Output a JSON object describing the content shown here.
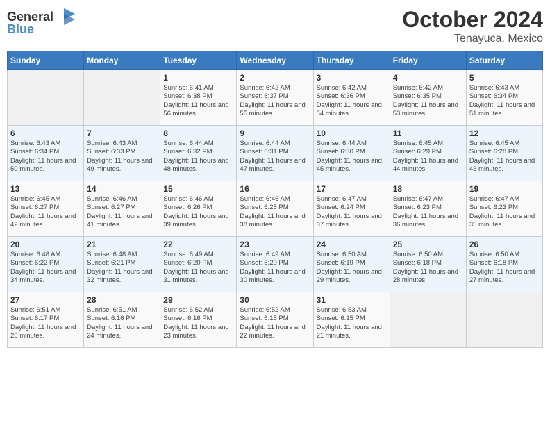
{
  "header": {
    "logo_general": "General",
    "logo_blue": "Blue",
    "month_title": "October 2024",
    "location": "Tenayuca, Mexico"
  },
  "weekdays": [
    "Sunday",
    "Monday",
    "Tuesday",
    "Wednesday",
    "Thursday",
    "Friday",
    "Saturday"
  ],
  "weeks": [
    [
      {
        "day": "",
        "info": ""
      },
      {
        "day": "",
        "info": ""
      },
      {
        "day": "1",
        "info": "Sunrise: 6:41 AM\nSunset: 6:38 PM\nDaylight: 11 hours and 56 minutes."
      },
      {
        "day": "2",
        "info": "Sunrise: 6:42 AM\nSunset: 6:37 PM\nDaylight: 11 hours and 55 minutes."
      },
      {
        "day": "3",
        "info": "Sunrise: 6:42 AM\nSunset: 6:36 PM\nDaylight: 11 hours and 54 minutes."
      },
      {
        "day": "4",
        "info": "Sunrise: 6:42 AM\nSunset: 6:35 PM\nDaylight: 11 hours and 53 minutes."
      },
      {
        "day": "5",
        "info": "Sunrise: 6:43 AM\nSunset: 6:34 PM\nDaylight: 11 hours and 51 minutes."
      }
    ],
    [
      {
        "day": "6",
        "info": "Sunrise: 6:43 AM\nSunset: 6:34 PM\nDaylight: 11 hours and 50 minutes."
      },
      {
        "day": "7",
        "info": "Sunrise: 6:43 AM\nSunset: 6:33 PM\nDaylight: 11 hours and 49 minutes."
      },
      {
        "day": "8",
        "info": "Sunrise: 6:44 AM\nSunset: 6:32 PM\nDaylight: 11 hours and 48 minutes."
      },
      {
        "day": "9",
        "info": "Sunrise: 6:44 AM\nSunset: 6:31 PM\nDaylight: 11 hours and 47 minutes."
      },
      {
        "day": "10",
        "info": "Sunrise: 6:44 AM\nSunset: 6:30 PM\nDaylight: 11 hours and 45 minutes."
      },
      {
        "day": "11",
        "info": "Sunrise: 6:45 AM\nSunset: 6:29 PM\nDaylight: 11 hours and 44 minutes."
      },
      {
        "day": "12",
        "info": "Sunrise: 6:45 AM\nSunset: 6:28 PM\nDaylight: 11 hours and 43 minutes."
      }
    ],
    [
      {
        "day": "13",
        "info": "Sunrise: 6:45 AM\nSunset: 6:27 PM\nDaylight: 11 hours and 42 minutes."
      },
      {
        "day": "14",
        "info": "Sunrise: 6:46 AM\nSunset: 6:27 PM\nDaylight: 11 hours and 41 minutes."
      },
      {
        "day": "15",
        "info": "Sunrise: 6:46 AM\nSunset: 6:26 PM\nDaylight: 11 hours and 39 minutes."
      },
      {
        "day": "16",
        "info": "Sunrise: 6:46 AM\nSunset: 6:25 PM\nDaylight: 11 hours and 38 minutes."
      },
      {
        "day": "17",
        "info": "Sunrise: 6:47 AM\nSunset: 6:24 PM\nDaylight: 11 hours and 37 minutes."
      },
      {
        "day": "18",
        "info": "Sunrise: 6:47 AM\nSunset: 6:23 PM\nDaylight: 11 hours and 36 minutes."
      },
      {
        "day": "19",
        "info": "Sunrise: 6:47 AM\nSunset: 6:23 PM\nDaylight: 11 hours and 35 minutes."
      }
    ],
    [
      {
        "day": "20",
        "info": "Sunrise: 6:48 AM\nSunset: 6:22 PM\nDaylight: 11 hours and 34 minutes."
      },
      {
        "day": "21",
        "info": "Sunrise: 6:48 AM\nSunset: 6:21 PM\nDaylight: 11 hours and 32 minutes."
      },
      {
        "day": "22",
        "info": "Sunrise: 6:49 AM\nSunset: 6:20 PM\nDaylight: 11 hours and 31 minutes."
      },
      {
        "day": "23",
        "info": "Sunrise: 6:49 AM\nSunset: 6:20 PM\nDaylight: 11 hours and 30 minutes."
      },
      {
        "day": "24",
        "info": "Sunrise: 6:50 AM\nSunset: 6:19 PM\nDaylight: 11 hours and 29 minutes."
      },
      {
        "day": "25",
        "info": "Sunrise: 6:50 AM\nSunset: 6:18 PM\nDaylight: 11 hours and 28 minutes."
      },
      {
        "day": "26",
        "info": "Sunrise: 6:50 AM\nSunset: 6:18 PM\nDaylight: 11 hours and 27 minutes."
      }
    ],
    [
      {
        "day": "27",
        "info": "Sunrise: 6:51 AM\nSunset: 6:17 PM\nDaylight: 11 hours and 26 minutes."
      },
      {
        "day": "28",
        "info": "Sunrise: 6:51 AM\nSunset: 6:16 PM\nDaylight: 11 hours and 24 minutes."
      },
      {
        "day": "29",
        "info": "Sunrise: 6:52 AM\nSunset: 6:16 PM\nDaylight: 11 hours and 23 minutes."
      },
      {
        "day": "30",
        "info": "Sunrise: 6:52 AM\nSunset: 6:15 PM\nDaylight: 11 hours and 22 minutes."
      },
      {
        "day": "31",
        "info": "Sunrise: 6:53 AM\nSunset: 6:15 PM\nDaylight: 11 hours and 21 minutes."
      },
      {
        "day": "",
        "info": ""
      },
      {
        "day": "",
        "info": ""
      }
    ]
  ]
}
